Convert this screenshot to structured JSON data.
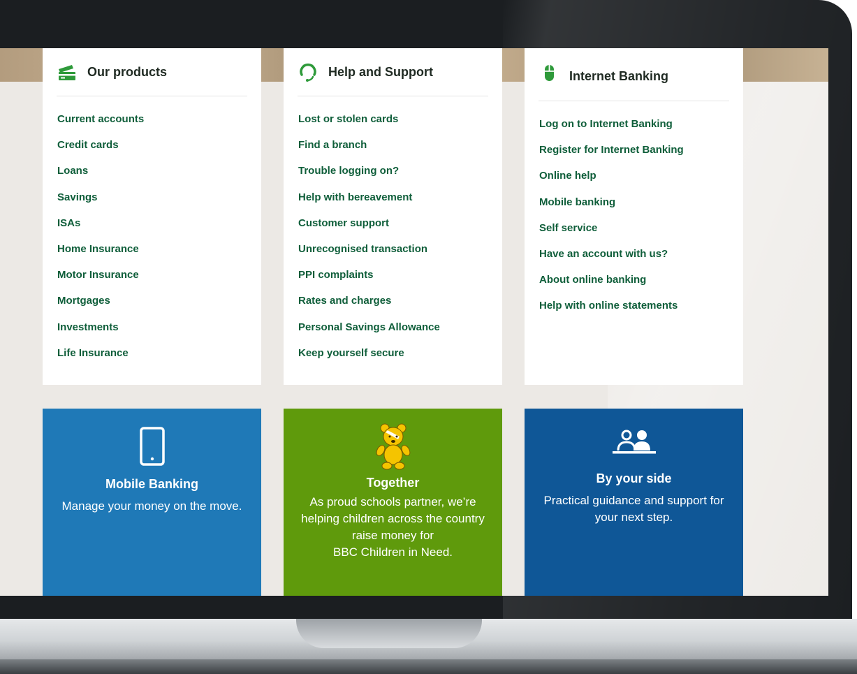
{
  "products": {
    "title": "Our products",
    "icon": "card-stack-icon",
    "links": [
      "Current accounts",
      "Credit cards",
      "Loans",
      "Savings",
      "ISAs",
      "Home Insurance",
      "Motor Insurance",
      "Mortgages",
      "Investments",
      "Life Insurance"
    ]
  },
  "support": {
    "title": "Help and Support",
    "icon": "headset-icon",
    "links": [
      "Lost or stolen cards",
      "Find a branch",
      "Trouble logging on?",
      "Help with bereavement",
      "Customer support",
      "Unrecognised transaction",
      "PPI complaints",
      "Rates and charges",
      "Personal Savings Allowance",
      "Keep yourself secure"
    ]
  },
  "internet_banking": {
    "title": "Internet Banking",
    "icon": "mouse-icon",
    "links": [
      "Log on to Internet Banking",
      "Register for Internet Banking",
      "Online help",
      "Mobile banking",
      "Self service",
      "Have an account with us?",
      "About online banking",
      "Help with online statements"
    ]
  },
  "tiles": {
    "mobile": {
      "title": "Mobile Banking",
      "text": "Manage your money on the move.",
      "icon": "smartphone-icon",
      "color": "#1f79b7"
    },
    "together": {
      "title": "Together",
      "text_lines": [
        "As proud schools partner, we’re",
        "helping children across the country",
        "raise money for",
        "BBC Children in Need."
      ],
      "icon": "pudsey-bear-icon",
      "color": "#5f9a0c"
    },
    "side": {
      "title": "By your side",
      "text_lines": [
        "Practical guidance and support for",
        "your next step."
      ],
      "icon": "two-people-icon",
      "color": "#0f5797"
    }
  },
  "colors": {
    "link": "#0f5e3a",
    "accent_green": "#2e9a3a",
    "page_bg": "#ece9e5"
  }
}
